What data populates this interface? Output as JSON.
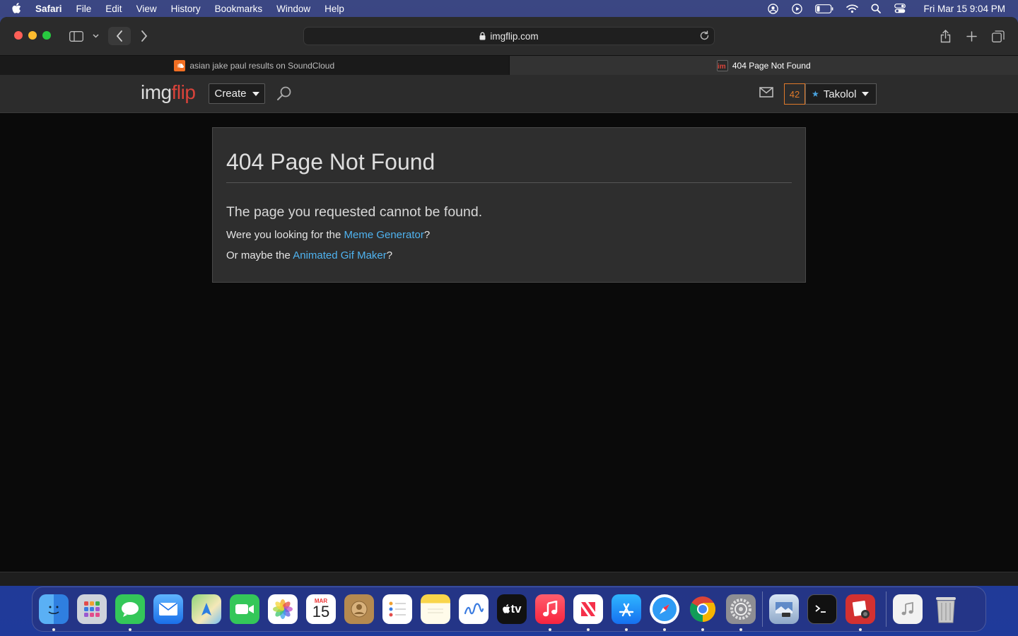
{
  "menubar": {
    "app_name": "Safari",
    "items": [
      "File",
      "Edit",
      "View",
      "History",
      "Bookmarks",
      "Window",
      "Help"
    ],
    "clock": "Fri Mar 15  9:04 PM"
  },
  "browser": {
    "url": "imgflip.com",
    "tabs": [
      {
        "label": "asian jake paul results on SoundCloud",
        "active": false
      },
      {
        "label": "404 Page Not Found",
        "active": true
      }
    ]
  },
  "site": {
    "logo_img": "img",
    "logo_flip": "flip",
    "create_label": "Create",
    "notification_count": "42",
    "username": "Takolol"
  },
  "content": {
    "title": "404 Page Not Found",
    "lead": "The page you requested cannot be found.",
    "line1_prefix": "Were you looking for the ",
    "line1_link": "Meme Generator",
    "line1_suffix": "?",
    "line2_prefix": "Or maybe the ",
    "line2_link": "Animated Gif Maker",
    "line2_suffix": "?"
  },
  "dock": {
    "calendar_month": "MAR",
    "calendar_day": "15",
    "appletv_label": "tv"
  },
  "colors": {
    "accent_link": "#4fb3f0",
    "brand_red": "#d9433a",
    "notif_orange": "#e07a2a"
  }
}
